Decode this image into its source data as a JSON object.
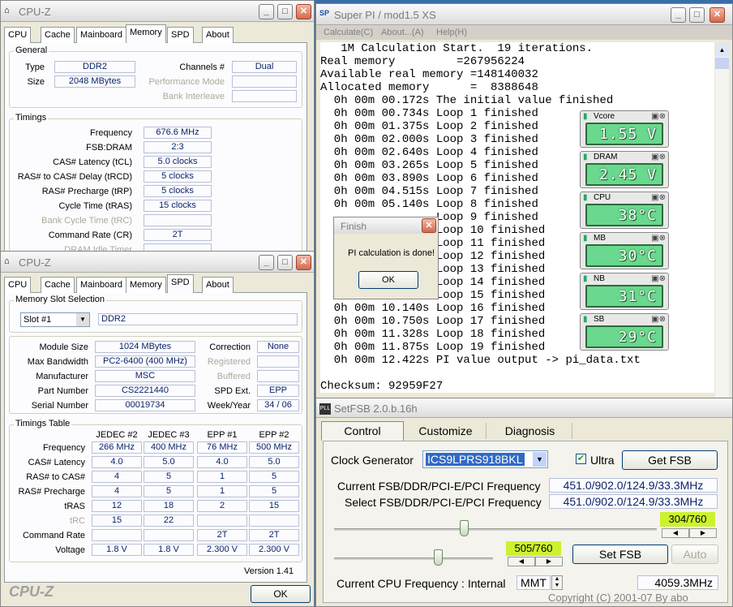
{
  "cpuz1": {
    "title": "CPU-Z",
    "tabs": [
      "CPU",
      "Cache",
      "Mainboard",
      "Memory",
      "SPD",
      "About"
    ],
    "general_label": "General",
    "type_label": "Type",
    "type": "DDR2",
    "size_label": "Size",
    "size": "2048 MBytes",
    "channels_label": "Channels #",
    "channels": "Dual",
    "perf_mode_label": "Performance Mode",
    "bank_interleave_label": "Bank Interleave",
    "timings_label": "Timings",
    "timings": [
      {
        "label": "Frequency",
        "value": "676.6 MHz",
        "disabled": false
      },
      {
        "label": "FSB:DRAM",
        "value": "2:3",
        "disabled": false
      },
      {
        "label": "CAS# Latency (tCL)",
        "value": "5.0 clocks",
        "disabled": false
      },
      {
        "label": "RAS# to CAS# Delay (tRCD)",
        "value": "5 clocks",
        "disabled": false
      },
      {
        "label": "RAS# Precharge (tRP)",
        "value": "5 clocks",
        "disabled": false
      },
      {
        "label": "Cycle Time (tRAS)",
        "value": "15 clocks",
        "disabled": false
      },
      {
        "label": "Bank Cycle Time (tRC)",
        "value": "",
        "disabled": true
      },
      {
        "label": "Command Rate (CR)",
        "value": "2T",
        "disabled": false
      },
      {
        "label": "DRAM Idle Timer",
        "value": "",
        "disabled": true
      }
    ]
  },
  "cpuz2": {
    "title": "CPU-Z",
    "tabs": [
      "CPU",
      "Cache",
      "Mainboard",
      "Memory",
      "SPD",
      "About"
    ],
    "slot_group": "Memory Slot Selection",
    "slot": "Slot #1",
    "slot_type": "DDR2",
    "module_size_label": "Module Size",
    "module_size": "1024 MBytes",
    "max_bw_label": "Max Bandwidth",
    "max_bw": "PC2-6400 (400 MHz)",
    "manufacturer_label": "Manufacturer",
    "manufacturer": "MSC",
    "part_label": "Part Number",
    "part": "CS2221440",
    "serial_label": "Serial Number",
    "serial": "00019734",
    "correction_label": "Correction",
    "correction": "None",
    "registered_label": "Registered",
    "buffered_label": "Buffered",
    "spd_ext_label": "SPD Ext.",
    "spd_ext": "EPP",
    "week_year_label": "Week/Year",
    "week_year": "34 / 06",
    "timings_table_label": "Timings Table",
    "cols": [
      "JEDEC #2",
      "JEDEC #3",
      "EPP #1",
      "EPP #2"
    ],
    "rows": [
      {
        "label": "Frequency",
        "vals": [
          "266 MHz",
          "400 MHz",
          "76 MHz",
          "500 MHz"
        ],
        "disabled": false
      },
      {
        "label": "CAS# Latency",
        "vals": [
          "4.0",
          "5.0",
          "4.0",
          "5.0"
        ],
        "disabled": false
      },
      {
        "label": "RAS# to CAS#",
        "vals": [
          "4",
          "5",
          "1",
          "5"
        ],
        "disabled": false
      },
      {
        "label": "RAS# Precharge",
        "vals": [
          "4",
          "5",
          "1",
          "5"
        ],
        "disabled": false
      },
      {
        "label": "tRAS",
        "vals": [
          "12",
          "18",
          "2",
          "15"
        ],
        "disabled": false
      },
      {
        "label": "tRC",
        "vals": [
          "15",
          "22",
          "",
          ""
        ],
        "disabled": true
      },
      {
        "label": "Command Rate",
        "vals": [
          "",
          "",
          "2T",
          "2T"
        ],
        "disabled": false
      },
      {
        "label": "Voltage",
        "vals": [
          "1.8 V",
          "1.8 V",
          "2.300 V",
          "2.300 V"
        ],
        "disabled": false
      }
    ],
    "version": "Version 1.41",
    "brand": "CPU-Z",
    "ok": "OK"
  },
  "superpi": {
    "title": "Super PI / mod1.5 XS",
    "menu": [
      "Calculate(C)",
      "About...(A)",
      "Help(H)"
    ],
    "lines": [
      "   1M Calculation Start.  19 iterations.",
      "Real memory         =267956224",
      "Available real memory =148140032",
      "Allocated memory      =  8388648",
      "  0h 00m 00.172s The initial value finished",
      "  0h 00m 00.734s Loop 1 finished",
      "  0h 00m 01.375s Loop 2 finished",
      "  0h 00m 02.000s Loop 3 finished",
      "  0h 00m 02.640s Loop 4 finished",
      "  0h 00m 03.265s Loop 5 finished",
      "  0h 00m 03.890s Loop 6 finished",
      "  0h 00m 04.515s Loop 7 finished",
      "  0h 00m 05.140s Loop 8 finished",
      "                 Loop 9 finished",
      "                 Loop 10 finished",
      "                 Loop 11 finished",
      "                 Loop 12 finished",
      "                 Loop 13 finished",
      "                 Loop 14 finished",
      "                 Loop 15 finished",
      "  0h 00m 10.140s Loop 16 finished",
      "  0h 00m 10.750s Loop 17 finished",
      "  0h 00m 11.328s Loop 18 finished",
      "  0h 00m 11.875s Loop 19 finished",
      "  0h 00m 12.422s PI value output -> pi_data.txt",
      "",
      "Checksum: 92959F27"
    ]
  },
  "finish": {
    "title": "Finish",
    "message": "PI calculation is done!",
    "ok": "OK"
  },
  "monitors": [
    {
      "name": "Vcore",
      "value": "1.55 V"
    },
    {
      "name": "DRAM",
      "value": "2.45 V"
    },
    {
      "name": "CPU",
      "value": "38°C"
    },
    {
      "name": "MB",
      "value": "30°C"
    },
    {
      "name": "NB",
      "value": "31°C"
    },
    {
      "name": "SB",
      "value": "29°C"
    }
  ],
  "setfsb": {
    "title": "SetFSB 2.0.b.16h",
    "tabs": [
      "Control",
      "Customize",
      "Diagnosis"
    ],
    "clock_gen_label": "Clock Generator",
    "clock_gen": "ICS9LPRS918BKL",
    "ultra_label": "Ultra",
    "ultra_checked": true,
    "get_fsb": "Get FSB",
    "current_label": "Current FSB/DDR/PCI-E/PCI Frequency",
    "current": "451.0/902.0/124.9/33.3MHz",
    "select_label": "Select FSB/DDR/PCI-E/PCI Frequency",
    "select": "451.0/902.0/124.9/33.3MHz",
    "slider1_readout": "304/760",
    "slider1_fraction": 0.4,
    "slider2_readout": "505/760",
    "slider2_fraction": 0.664,
    "set_fsb": "Set FSB",
    "auto": "Auto",
    "cpu_freq_label": "Current CPU Frequency : Internal",
    "mmt": "MMT",
    "cpu_freq": "4059.3MHz",
    "copyright": "Copyright (C) 2001-07 By abo"
  }
}
